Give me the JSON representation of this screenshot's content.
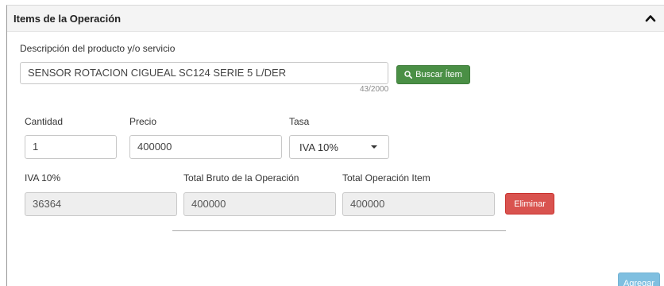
{
  "panel": {
    "title": "Items de la Operación",
    "collapse_icon": "chevron-up-icon"
  },
  "description": {
    "label": "Descripción del producto y/o servicio",
    "value": "SENSOR ROTACION CIGUEAL SC124 SERIE 5 L/DER",
    "counter": "43/2000",
    "search_button": "Buscar Ítem",
    "search_icon": "search-icon"
  },
  "quantity": {
    "label": "Cantidad",
    "value": "1"
  },
  "price": {
    "label": "Precio",
    "value": "400000"
  },
  "rate": {
    "label": "Tasa",
    "selected": "IVA 10%"
  },
  "iva": {
    "label": "IVA 10%",
    "value": "36364"
  },
  "gross_total": {
    "label": "Total Bruto de la Operación",
    "value": "400000"
  },
  "item_total": {
    "label": "Total Operación Item",
    "value": "400000"
  },
  "actions": {
    "delete": "Eliminar",
    "add": "Agregar"
  },
  "colors": {
    "search_button": "#4a8f45",
    "delete_button": "#d9534f",
    "add_button": "#7fbfe0",
    "header_bg": "#f4f4f4"
  }
}
